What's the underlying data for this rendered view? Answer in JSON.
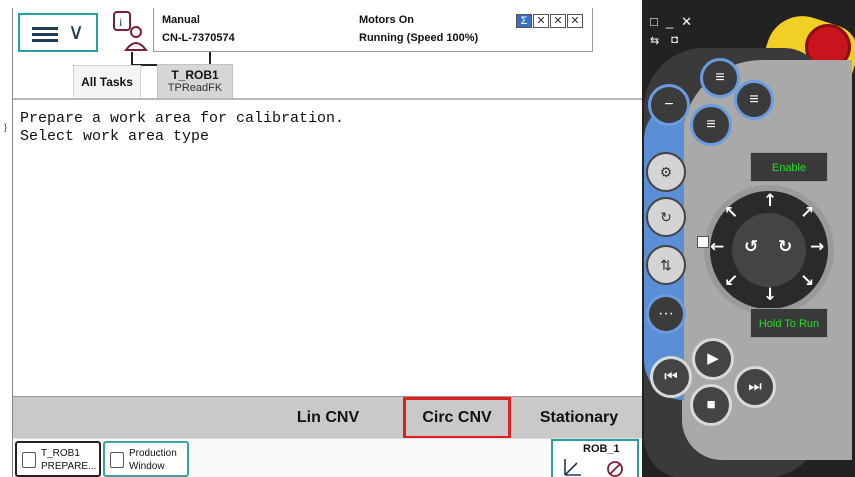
{
  "header": {
    "menu_icon": "hamburger-menu-icon",
    "status_icon": "operator-window-icon",
    "mode": "Manual",
    "system_name": "CN-L-7370574",
    "motors": "Motors On",
    "running": "Running (Speed 100%)"
  },
  "tabs": [
    {
      "label": "All Tasks"
    },
    {
      "label": "T_ROB1",
      "sublabel": "TPReadFK"
    }
  ],
  "message": {
    "line1": "Prepare a work area for calibration.",
    "line2": "Select work area type",
    "margin_mark": "}"
  },
  "buttons": {
    "lin": "Lin CNV",
    "circ": "Circ CNV",
    "stationary": "Stationary",
    "highlight_color": "#e02020"
  },
  "taskbar": {
    "task1_line1": "T_ROB1",
    "task1_line2": "PREPARE...",
    "task2_line1": "Production",
    "task2_line2": "Window",
    "robot": "ROB_1"
  },
  "pendant": {
    "enable": "Enable",
    "hold": "Hold To Run",
    "accent_color": "#5a8fd6",
    "estop_color": "#c8141c",
    "yellow_color": "#f1cf24"
  }
}
